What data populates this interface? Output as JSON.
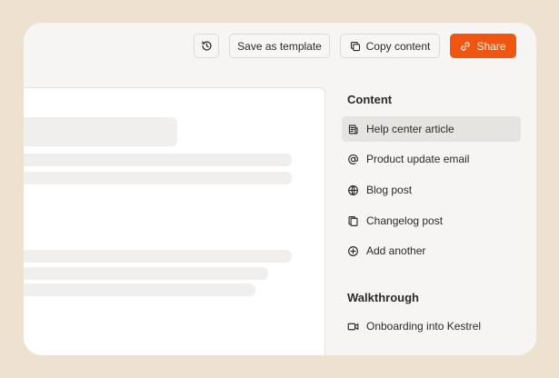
{
  "toolbar": {
    "history_icon": "history-icon",
    "save_template_label": "Save as template",
    "copy_content_label": "Copy content",
    "share_label": "Share",
    "share_color": "#f0560f"
  },
  "sidebar": {
    "content_title": "Content",
    "content_items": [
      {
        "label": "Help center article",
        "icon": "article-icon",
        "active": true
      },
      {
        "label": "Product update email",
        "icon": "at-sign-icon",
        "active": false
      },
      {
        "label": "Blog post",
        "icon": "globe-icon",
        "active": false
      },
      {
        "label": "Changelog post",
        "icon": "copy-pages-icon",
        "active": false
      },
      {
        "label": "Add another",
        "icon": "plus-circle-icon",
        "active": false
      }
    ],
    "walkthrough_title": "Walkthrough",
    "walkthrough_items": [
      {
        "label": "Onboarding into Kestrel",
        "icon": "video-icon"
      }
    ]
  }
}
